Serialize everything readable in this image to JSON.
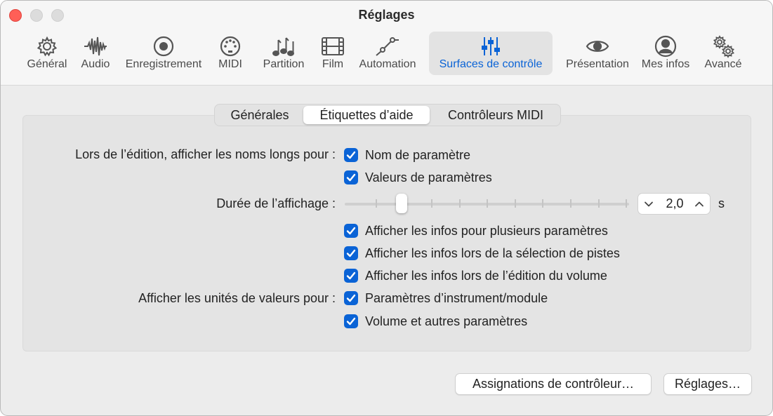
{
  "window": {
    "title": "Réglages"
  },
  "toolbar": {
    "items": [
      {
        "label": "Général",
        "icon": "gear-icon"
      },
      {
        "label": "Audio",
        "icon": "waveform-icon"
      },
      {
        "label": "Enregistrement",
        "icon": "record-icon"
      },
      {
        "label": "MIDI",
        "icon": "midi-port-icon"
      },
      {
        "label": "Partition",
        "icon": "music-notes-icon"
      },
      {
        "label": "Film",
        "icon": "film-strip-icon"
      },
      {
        "label": "Automation",
        "icon": "automation-curve-icon"
      },
      {
        "label": "Surfaces de contrôle",
        "icon": "sliders-icon",
        "selected": true
      },
      {
        "label": "Présentation",
        "icon": "eye-icon"
      },
      {
        "label": "Mes infos",
        "icon": "person-circle-icon"
      },
      {
        "label": "Avancé",
        "icon": "gears-icon"
      }
    ],
    "accent_color": "#0a63d6"
  },
  "tabs": {
    "items": [
      "Générales",
      "Étiquettes d’aide",
      "Contrôleurs MIDI"
    ],
    "selected": "Étiquettes d’aide"
  },
  "form": {
    "long_names_label": "Lors de l’édition, afficher les noms longs pour :",
    "param_name": {
      "label": "Nom de paramètre",
      "checked": true
    },
    "param_values": {
      "label": "Valeurs de paramètres",
      "checked": true
    },
    "duration_label": "Durée de l’affichage :",
    "duration_slider": {
      "position": 0.2
    },
    "duration_value": "2,0",
    "duration_unit": "s",
    "multi_params": {
      "label": "Afficher les infos pour plusieurs paramètres",
      "checked": true
    },
    "track_select": {
      "label": "Afficher les infos lors de la sélection de pistes",
      "checked": true
    },
    "volume_edit": {
      "label": "Afficher les infos lors de l’édition du volume",
      "checked": true
    },
    "units_label": "Afficher les unités de valeurs pour :",
    "instrument_params": {
      "label": "Paramètres d’instrument/module",
      "checked": true
    },
    "volume_other": {
      "label": "Volume et autres paramètres",
      "checked": true
    }
  },
  "buttons": {
    "controller_assignments": "Assignations de contrôleur…",
    "settings": "Réglages…"
  }
}
